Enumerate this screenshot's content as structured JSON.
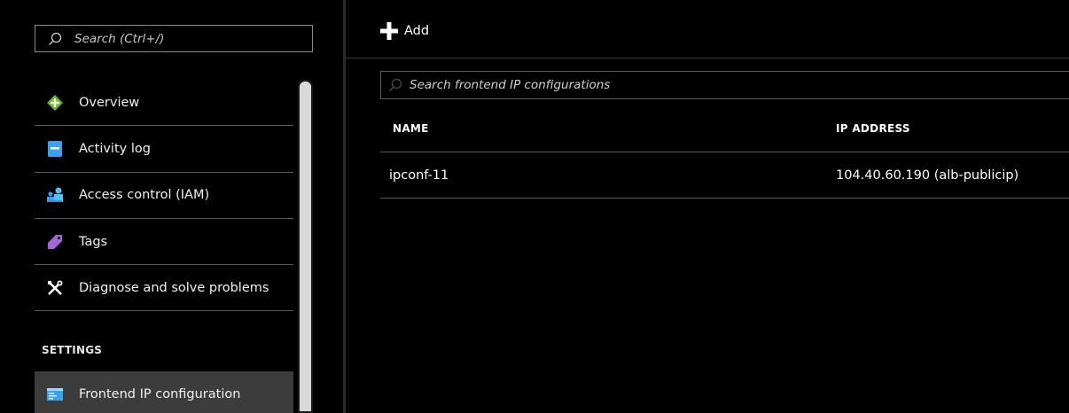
{
  "sidebar": {
    "search": {
      "placeholder": "Search (Ctrl+/)",
      "value": ""
    },
    "items": [
      {
        "label": "Overview",
        "icon": "overview-icon"
      },
      {
        "label": "Activity log",
        "icon": "activity-log-icon"
      },
      {
        "label": "Access control (IAM)",
        "icon": "access-control-icon"
      },
      {
        "label": "Tags",
        "icon": "tag-icon"
      },
      {
        "label": "Diagnose and solve problems",
        "icon": "wrench-cross-icon"
      }
    ],
    "settings_header": "SETTINGS",
    "active_item": {
      "label": "Frontend IP configuration",
      "icon": "frontend-ip-icon"
    }
  },
  "main": {
    "toolbar": {
      "add_label": "Add"
    },
    "filter": {
      "placeholder": "Search frontend IP configurations",
      "value": ""
    },
    "table": {
      "columns": [
        "NAME",
        "IP ADDRESS"
      ],
      "rows": [
        {
          "name": "ipconf-11",
          "ip_address": "104.40.60.190 (alb-publicip)"
        }
      ]
    }
  },
  "colors": {
    "background": "#000000",
    "active_item_bg": "#3c3c3c",
    "divider": "#5a5a5a",
    "overview_icon_green": "#5fb52f",
    "activity_icon_blue": "#3aa0f0",
    "tag_icon_purple": "#a366d8"
  }
}
